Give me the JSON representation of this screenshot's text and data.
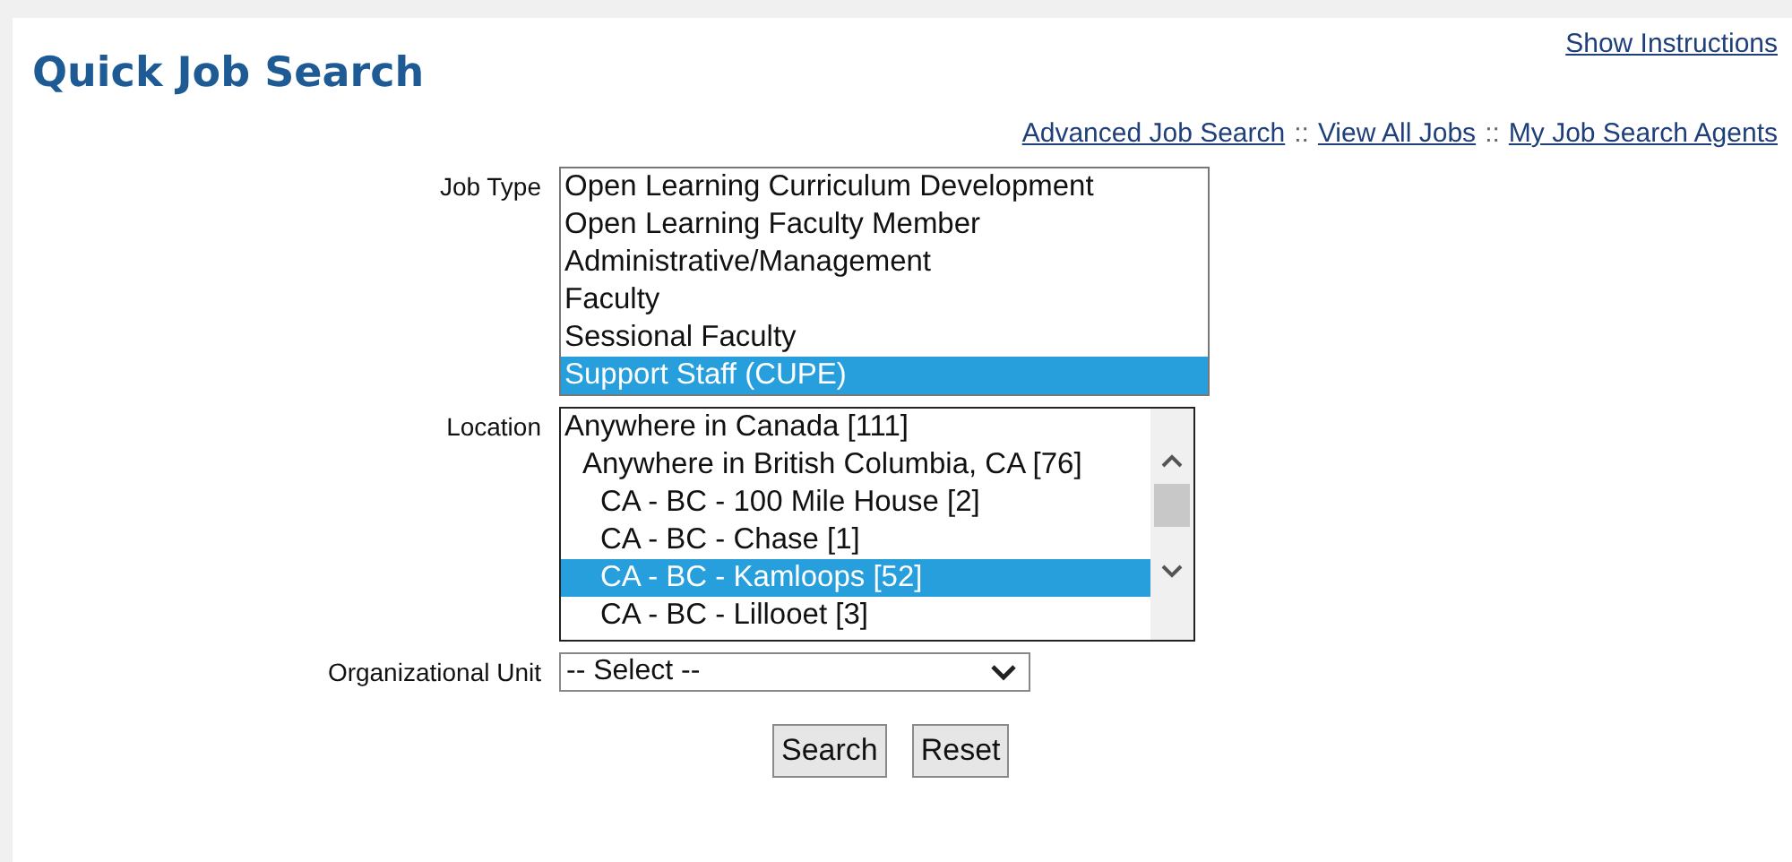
{
  "title": "Quick Job Search",
  "show_instructions": "Show Instructions",
  "links": [
    {
      "label": "Advanced Job Search "
    },
    {
      "label": "View All Jobs "
    },
    {
      "label": "My Job Search Agents"
    }
  ],
  "link_separator": "::",
  "job_type": {
    "label": "Job Type",
    "options": [
      {
        "label": "Open Learning Curriculum Development",
        "selected": false
      },
      {
        "label": "Open Learning Faculty Member",
        "selected": false
      },
      {
        "label": "Administrative/Management",
        "selected": false
      },
      {
        "label": "Faculty",
        "selected": false
      },
      {
        "label": "Sessional Faculty",
        "selected": false
      },
      {
        "label": "Support Staff (CUPE)",
        "selected": true
      }
    ]
  },
  "location": {
    "label": "Location",
    "options": [
      {
        "label": "Anywhere in Canada [111]",
        "selected": false,
        "children": [
          {
            "label": "Anywhere in British Columbia, CA [76]",
            "selected": false,
            "children": [
              {
                "label": "CA - BC - 100 Mile House [2]",
                "selected": false
              },
              {
                "label": "CA - BC - Chase [1]",
                "selected": false
              },
              {
                "label": "CA - BC - Kamloops [52]",
                "selected": true
              },
              {
                "label": "CA - BC - Lillooet [3]",
                "selected": false
              }
            ]
          }
        ]
      }
    ]
  },
  "org_unit": {
    "label": "Organizational Unit",
    "value": "-- Select --"
  },
  "buttons": [
    {
      "label": "Search"
    },
    {
      "label": "Reset"
    }
  ]
}
